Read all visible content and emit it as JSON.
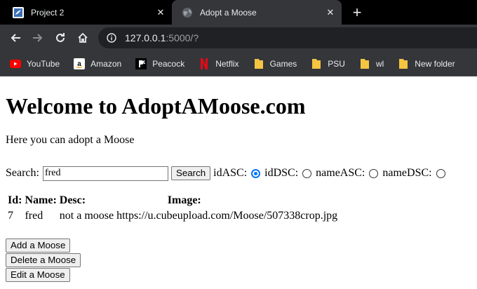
{
  "browser": {
    "tabs": [
      {
        "title": "Project 2",
        "favicon": "project-favicon",
        "active": false
      },
      {
        "title": "Adopt a Moose",
        "favicon": "globe-icon",
        "active": true
      }
    ],
    "address": {
      "host": "127.0.0.1",
      "rest": ":5000/?"
    },
    "bookmarks": [
      {
        "label": "YouTube",
        "icon": "youtube-icon"
      },
      {
        "label": "Amazon",
        "icon": "amazon-icon"
      },
      {
        "label": "Peacock",
        "icon": "peacock-icon"
      },
      {
        "label": "Netflix",
        "icon": "netflix-icon"
      },
      {
        "label": "Games",
        "icon": "folder-icon"
      },
      {
        "label": "PSU",
        "icon": "folder-icon"
      },
      {
        "label": "wl",
        "icon": "folder-icon"
      },
      {
        "label": "New folder",
        "icon": "folder-icon"
      }
    ]
  },
  "page": {
    "heading": "Welcome to AdoptAMoose.com",
    "intro": "Here you can adopt a Moose",
    "search": {
      "label": "Search:",
      "value": "fred",
      "button": "Search"
    },
    "sort": {
      "options": [
        {
          "label": "idASC:",
          "checked": true
        },
        {
          "label": "idDSC:",
          "checked": false
        },
        {
          "label": "nameASC:",
          "checked": false
        },
        {
          "label": "nameDSC:",
          "checked": false
        }
      ]
    },
    "table": {
      "headers": [
        "Id:",
        "Name:",
        "Desc:",
        "Image:"
      ],
      "rows": [
        [
          "7",
          "fred",
          "not a moose",
          "https://u.cubeupload.com/Moose/507338crop.jpg"
        ]
      ]
    },
    "actions": {
      "add": "Add a Moose",
      "delete": "Delete a Moose",
      "edit": "Edit a Moose"
    }
  },
  "colors": {
    "chrome_dark": "#35363a",
    "tabbar": "#000000",
    "radio_accent": "#0075ff"
  }
}
